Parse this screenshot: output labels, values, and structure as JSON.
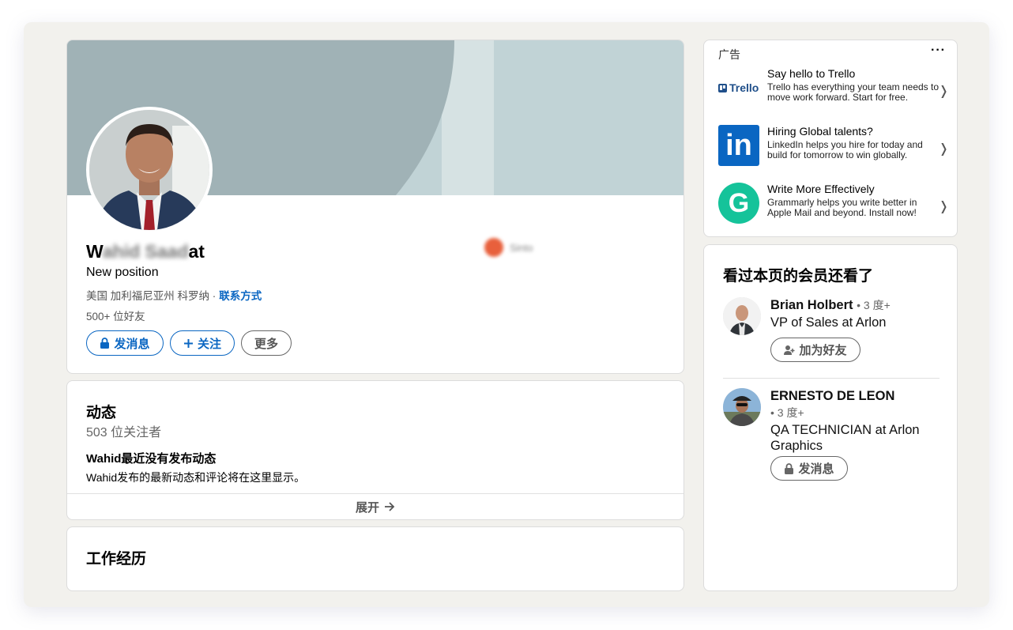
{
  "profile": {
    "name_start": "W",
    "name_blurred": "ahid Saad",
    "name_end": "at",
    "headline": "New position",
    "location": "美国 加利福尼亚州 科罗纳",
    "separator": "·",
    "contact_label": "联系方式",
    "connections": "500+ 位好友",
    "company_blurred": "Sinto",
    "buttons": {
      "message": "发消息",
      "follow": "关注",
      "more": "更多"
    }
  },
  "activity": {
    "title": "动态",
    "followers": "503 位关注者",
    "empty_title": "Wahid最近没有发布动态",
    "empty_desc": "Wahid发布的最新动态和评论将在这里显示。",
    "expand_label": "展开"
  },
  "experience": {
    "title": "工作经历"
  },
  "ads": {
    "label": "广告",
    "more": "···",
    "items": [
      {
        "logo_text": "Trello",
        "title": "Say hello to Trello",
        "desc": "Trello has everything your team needs to move work forward. Start for free.",
        "chevron": "❭"
      },
      {
        "logo_text": "in",
        "title": "Hiring Global talents?",
        "desc": "LinkedIn helps you hire for today and build for tomorrow to win globally.",
        "chevron": "❭"
      },
      {
        "logo_text": "G",
        "title": "Write More Effectively",
        "desc": "Grammarly helps you write better in Apple Mail and beyond. Install now!",
        "chevron": "❭"
      }
    ]
  },
  "viewers": {
    "title": "看过本页的会员还看了",
    "people": [
      {
        "name": "Brian Holbert",
        "degree": "• 3 度+",
        "title": "VP of Sales at Arlon",
        "button": "加为好友"
      },
      {
        "name": "ERNESTO DE LEON",
        "degree": "• 3 度+",
        "title": "QA TECHNICIAN at Arlon Graphics",
        "button": "发消息"
      }
    ]
  },
  "colors": {
    "brand_blue": "#0a66c2",
    "banner_dark": "#a0b2b6",
    "banner_light": "#c1d3d6",
    "trello": "#1f4f8a",
    "linkedin": "#0a66c2",
    "grammarly": "#15c39a"
  }
}
